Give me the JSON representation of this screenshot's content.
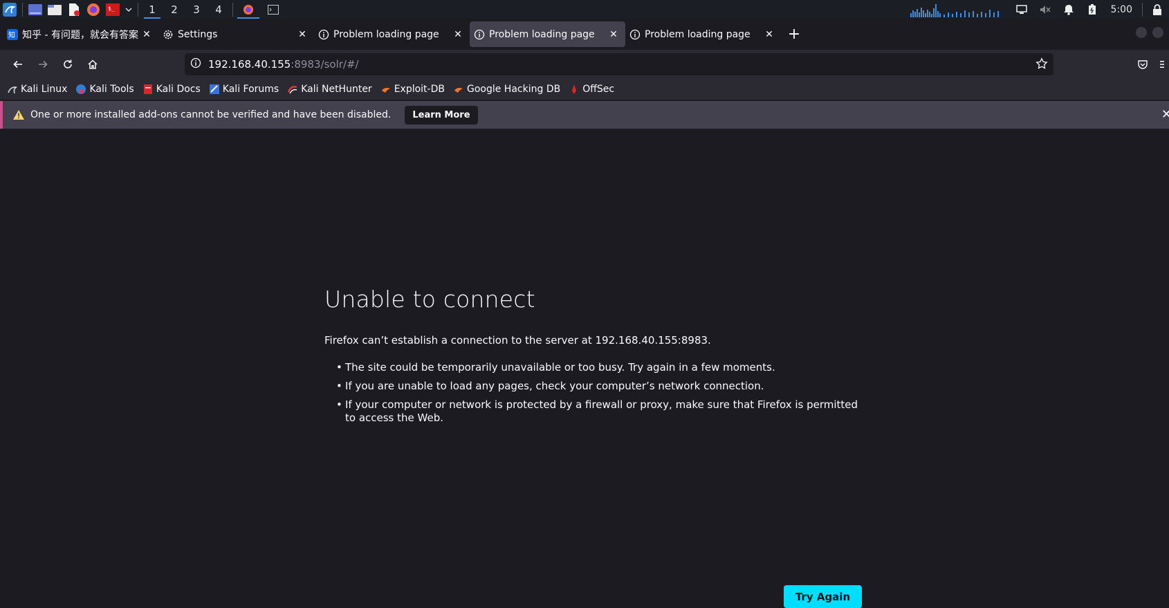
{
  "taskbar": {
    "workspaces": [
      "1",
      "2",
      "3",
      "4"
    ],
    "active_workspace": "1",
    "clock": "5:00"
  },
  "browser": {
    "tabs": [
      {
        "title": "知乎 - 有问题，就会有答案",
        "favicon": "zhihu-icon",
        "selected": false
      },
      {
        "title": "Settings",
        "favicon": "gear-icon",
        "selected": false
      },
      {
        "title": "Problem loading page",
        "favicon": "info-icon",
        "selected": false
      },
      {
        "title": "Problem loading page",
        "favicon": "info-icon",
        "selected": true
      },
      {
        "title": "Problem loading page",
        "favicon": "info-icon",
        "selected": false
      }
    ],
    "new_tab_label": "+",
    "url": {
      "host": "192.168.40.155",
      "rest": ":8983/solr/#/"
    },
    "bookmarks": [
      {
        "label": "Kali Linux",
        "icon": "kali-dragon-icon"
      },
      {
        "label": "Kali Tools",
        "icon": "kali-tools-icon"
      },
      {
        "label": "Kali Docs",
        "icon": "kali-docs-icon"
      },
      {
        "label": "Kali Forums",
        "icon": "kali-forums-icon"
      },
      {
        "label": "Kali NetHunter",
        "icon": "nethunter-icon"
      },
      {
        "label": "Exploit-DB",
        "icon": "exploitdb-icon"
      },
      {
        "label": "Google Hacking DB",
        "icon": "ghdb-icon"
      },
      {
        "label": "OffSec",
        "icon": "offsec-icon"
      }
    ],
    "notification": {
      "message": "One or more installed add-ons cannot be verified and have been disabled.",
      "button": "Learn More"
    }
  },
  "error_page": {
    "title": "Unable to connect",
    "intro": "Firefox can’t establish a connection to the server at 192.168.40.155:8983.",
    "items": [
      "The site could be temporarily unavailable or too busy. Try again in a few moments.",
      "If you are unable to load any pages, check your computer’s network connection.",
      "If your computer or network is protected by a firewall or proxy, make sure that Firefox is permitted to access the Web."
    ],
    "button": "Try Again"
  },
  "colors": {
    "accent": "#00ddff",
    "page_bg": "#1c1b22",
    "toolbar_bg": "#2b2a33",
    "selected_tab": "#42414d"
  }
}
